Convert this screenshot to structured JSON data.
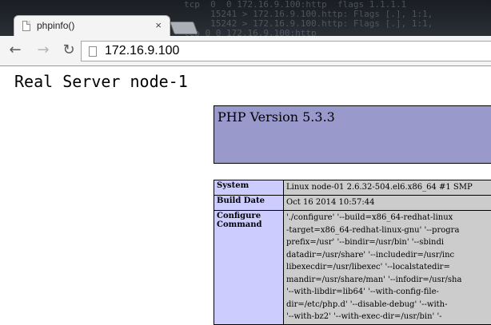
{
  "browser": {
    "tab_title": "phpinfo()",
    "tab_close": "×",
    "url": "172.16.9.100",
    "background_terminal": [
      "tcp  0  0 172.16.9.100:http  flags 1.1.1.1",
      "     15241 > 172.16.9.100.http: Flags [.], 1:1,",
      "     15242 > 172.16.9.100.http: Flags [.], 1:1,",
      "tcp 0 0 172.16.9.100:http"
    ]
  },
  "page": {
    "heading": "Real Server node-1",
    "php_version": "PHP Version 5.3.3",
    "table": [
      {
        "key": "System",
        "value": [
          "Linux node-01 2.6.32-504.el6.x86_64 #1 SMP"
        ]
      },
      {
        "key": "Build Date",
        "value": [
          "Oct 16 2014 10:57:44"
        ]
      },
      {
        "key": "Configure Command",
        "value": [
          "'./configure' '--build=x86_64-redhat-linux",
          "-target=x86_64-redhat-linux-gnu' '--progra",
          "prefix=/usr' '--bindir=/usr/bin' '--sbindi",
          "datadir=/usr/share' '--includedir=/usr/inc",
          "libexecdir=/usr/libexec' '--localstatedir=",
          "mandir=/usr/share/man' '--infodir=/usr/sha",
          "'--with-libdir=lib64' '--with-config-file-",
          "dir=/etc/php.d' '--disable-debug' '--with-",
          "'--with-bz2' '--with-exec-dir=/usr/bin' '-"
        ]
      }
    ]
  }
}
